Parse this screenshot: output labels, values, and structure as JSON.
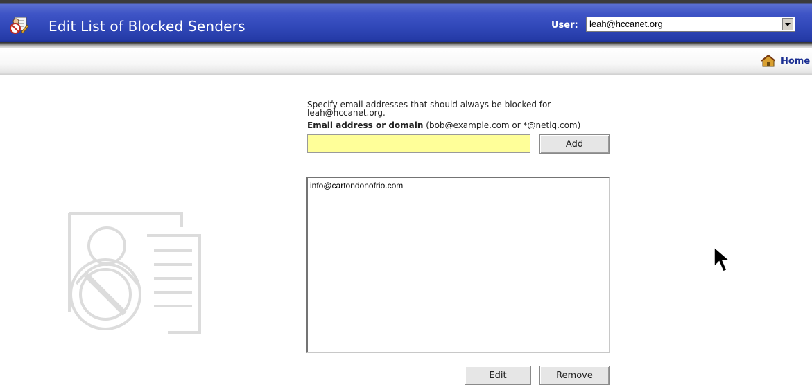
{
  "header": {
    "title": "Edit List of Blocked Senders",
    "user_label": "User:",
    "user_value": "leah@hccanet.org",
    "title_icon": "blocked-senders-icon",
    "dropdown_icon": "chevron-down-icon"
  },
  "nav": {
    "home_label": "Home",
    "home_icon": "home-icon"
  },
  "form": {
    "intro_line1": "Specify email addresses that should always be blocked for",
    "intro_line2": "leah@hccanet.org.",
    "field_label": "Email address or domain",
    "field_hint": "(bob@example.com or *@netiq.com)",
    "email_value": "",
    "add_label": "Add"
  },
  "list": {
    "items": [
      "info@cartondonofrio.com"
    ]
  },
  "actions": {
    "edit_label": "Edit",
    "remove_label": "Remove"
  },
  "colors": {
    "title_bar": "#3047b8",
    "input_highlight": "#ffff99",
    "link": "#1b2f92"
  }
}
